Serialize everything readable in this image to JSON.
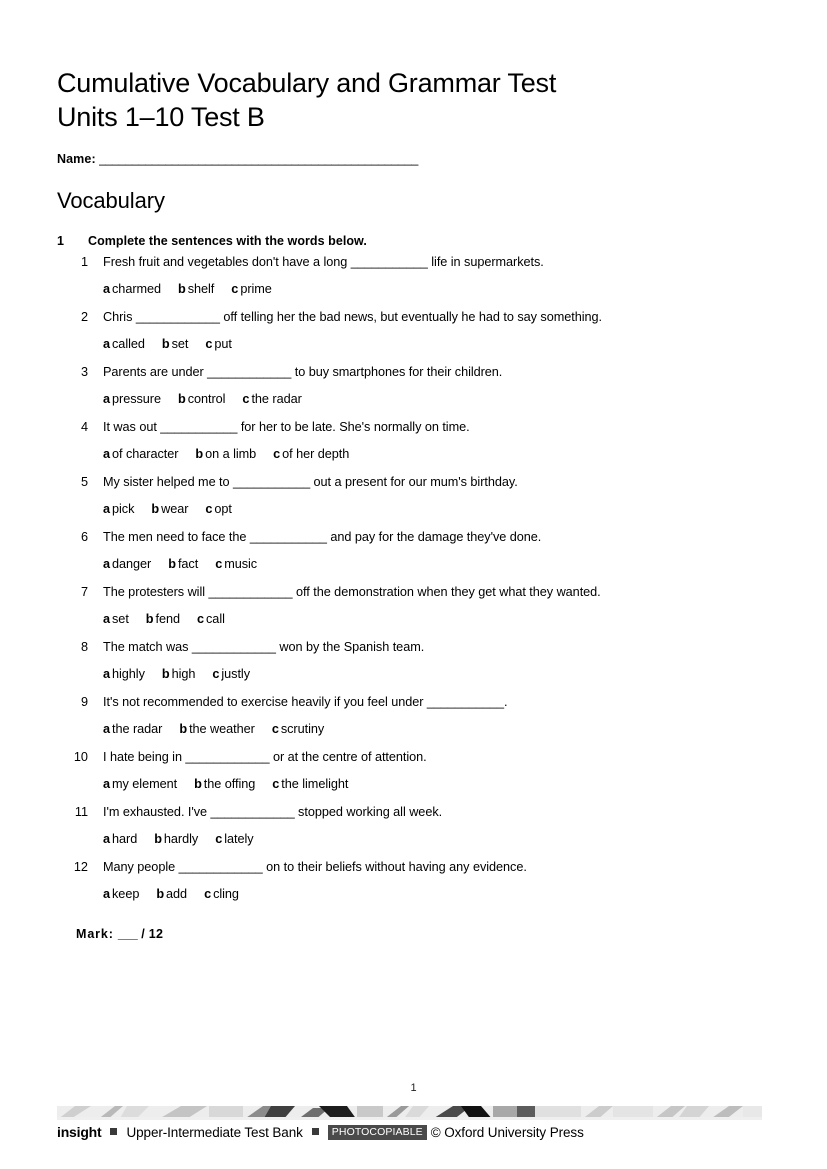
{
  "document": {
    "title": "Cumulative Vocabulary and Grammar Test\nUnits 1–10 Test B",
    "name_label": "Name:",
    "name_rule": "________________________________________________",
    "section_heading": "Vocabulary",
    "page_number": "1"
  },
  "exercise": {
    "number": "1",
    "instruction": "Complete the sentences with the words below.",
    "mark_label": "Mark:",
    "mark_blank": "___",
    "mark_total": "/ 12",
    "questions": [
      {
        "number": "1",
        "text": "Fresh fruit and vegetables don't have a long ___________ life in supermarkets.",
        "options": [
          {
            "letter": "a",
            "word": "charmed"
          },
          {
            "letter": "b",
            "word": "shelf"
          },
          {
            "letter": "c",
            "word": "prime"
          }
        ]
      },
      {
        "number": "2",
        "text": "Chris ____________ off telling her the bad news, but eventually he had to say something.",
        "options": [
          {
            "letter": "a",
            "word": "called"
          },
          {
            "letter": "b",
            "word": "set"
          },
          {
            "letter": "c",
            "word": "put"
          }
        ]
      },
      {
        "number": "3",
        "text": "Parents are under ____________ to buy smartphones for their children.",
        "options": [
          {
            "letter": "a",
            "word": "pressure"
          },
          {
            "letter": "b",
            "word": "control"
          },
          {
            "letter": "c",
            "word": "the radar"
          }
        ]
      },
      {
        "number": "4",
        "text": "It was out ___________ for her to be late. She's normally on time.",
        "options": [
          {
            "letter": "a",
            "word": "of character"
          },
          {
            "letter": "b",
            "word": "on a limb"
          },
          {
            "letter": "c",
            "word": "of her depth"
          }
        ]
      },
      {
        "number": "5",
        "text": "My sister helped me to ___________ out a present for our mum's birthday.",
        "options": [
          {
            "letter": "a",
            "word": "pick"
          },
          {
            "letter": "b",
            "word": "wear"
          },
          {
            "letter": "c",
            "word": "opt"
          }
        ]
      },
      {
        "number": "6",
        "text": "The men need to face the ___________ and pay for the damage they've done.",
        "options": [
          {
            "letter": "a",
            "word": "danger"
          },
          {
            "letter": "b",
            "word": "fact"
          },
          {
            "letter": "c",
            "word": "music"
          }
        ]
      },
      {
        "number": "7",
        "text": "The protesters will ____________ off the demonstration when they get what they wanted.",
        "options": [
          {
            "letter": "a",
            "word": "set"
          },
          {
            "letter": "b",
            "word": "fend"
          },
          {
            "letter": "c",
            "word": "call"
          }
        ]
      },
      {
        "number": "8",
        "text": "The match was ____________ won by the Spanish team.",
        "options": [
          {
            "letter": "a",
            "word": "highly"
          },
          {
            "letter": "b",
            "word": "high"
          },
          {
            "letter": "c",
            "word": "justly"
          }
        ]
      },
      {
        "number": "9",
        "text": "It's not recommended to exercise heavily if you feel under ___________.",
        "options": [
          {
            "letter": "a",
            "word": "the radar"
          },
          {
            "letter": "b",
            "word": "the weather"
          },
          {
            "letter": "c",
            "word": "scrutiny"
          }
        ]
      },
      {
        "number": "10",
        "text": "I hate being in ____________ or at the centre of attention.",
        "options": [
          {
            "letter": "a",
            "word": "my element"
          },
          {
            "letter": "b",
            "word": "the offing"
          },
          {
            "letter": "c",
            "word": "the limelight"
          }
        ]
      },
      {
        "number": "11",
        "text": "I'm exhausted. I've ____________ stopped working all week.",
        "options": [
          {
            "letter": "a",
            "word": "hard"
          },
          {
            "letter": "b",
            "word": "hardly"
          },
          {
            "letter": "c",
            "word": "lately"
          }
        ]
      },
      {
        "number": "12",
        "text": "Many people ____________ on to their beliefs without having any evidence.",
        "options": [
          {
            "letter": "a",
            "word": "keep"
          },
          {
            "letter": "b",
            "word": "add"
          },
          {
            "letter": "c",
            "word": "cling"
          }
        ]
      }
    ]
  },
  "footer": {
    "brand": "insight",
    "series": "Upper-Intermediate Test Bank",
    "photocopiable": "PHOTOCOPIABLE",
    "copyright": "© Oxford University Press"
  },
  "colors": {
    "text": "#000000",
    "badge_background": "#4a4a4a",
    "badge_text": "#ffffff",
    "separator": "#3a3a3a",
    "strip_background": "#e9e9e9"
  }
}
